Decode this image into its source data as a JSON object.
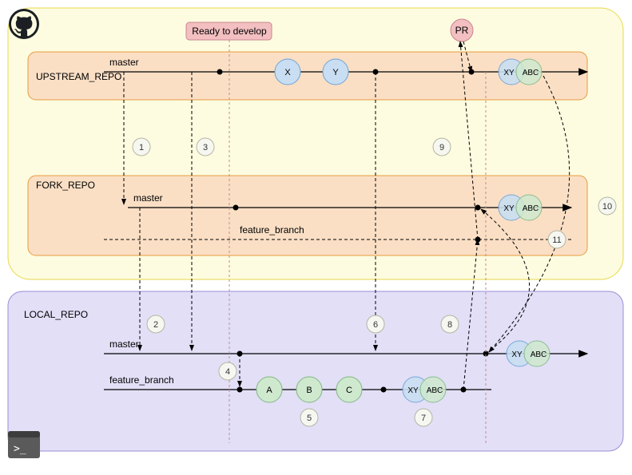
{
  "github_box": {
    "upstream": {
      "label": "UPSTREAM_REPO",
      "branch": "master"
    },
    "fork": {
      "label": "FORK_REPO",
      "branch_master": "master",
      "branch_feature": "feature_branch"
    }
  },
  "local_box": {
    "label": "LOCAL_REPO",
    "branch_master": "master",
    "branch_feature": "feature_branch"
  },
  "banners": {
    "ready": "Ready to develop",
    "pr": "PR"
  },
  "commits": {
    "X": "X",
    "Y": "Y",
    "A": "A",
    "B": "B",
    "C": "C",
    "XY": "XY",
    "ABC": "ABC"
  },
  "steps": {
    "1": "1",
    "2": "2",
    "3": "3",
    "4": "4",
    "5": "5",
    "6": "6",
    "7": "7",
    "8": "8",
    "9": "9",
    "10": "10",
    "11": "11"
  },
  "colors": {
    "github_bg": "#fdfce0",
    "github_stroke": "#e8d94a",
    "repo_bg": "#fadfc5",
    "repo_stroke": "#e89b3f",
    "local_bg": "#e2dff7",
    "local_stroke": "#9a8fd6",
    "banner_bg": "#f3bfc1",
    "banner_stroke": "#c7888e",
    "commit_blue_bg": "#c9def2",
    "commit_blue_stroke": "#6fa3d4",
    "commit_green_bg": "#cfe9cf",
    "commit_green_stroke": "#7fb77f",
    "step_bg": "#f7f7f2",
    "step_stroke": "#b5b5a0"
  }
}
